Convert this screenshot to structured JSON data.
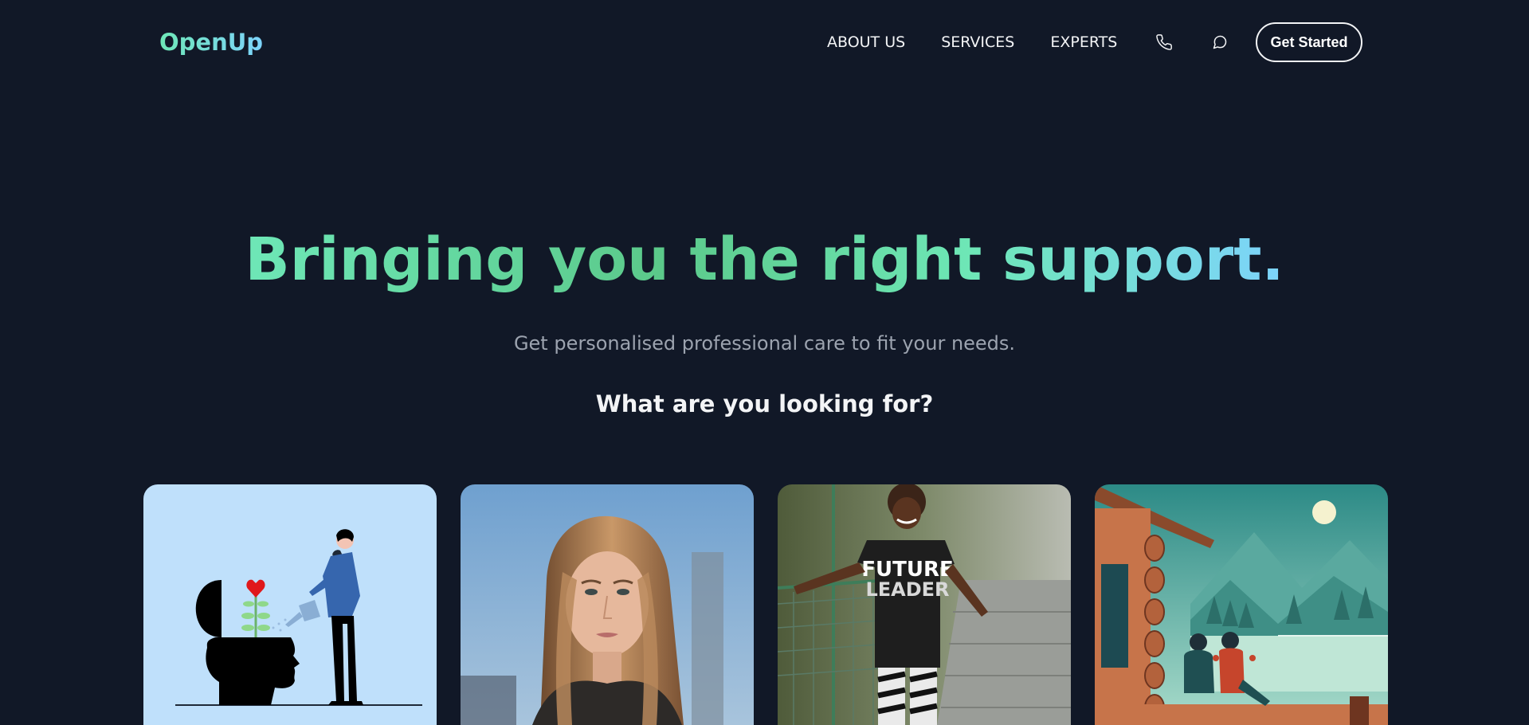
{
  "header": {
    "logo": "OpenUp",
    "nav": [
      {
        "label": "ABOUT US"
      },
      {
        "label": "SERVICES"
      },
      {
        "label": "EXPERTS"
      }
    ],
    "icons": [
      "phone-icon",
      "chat-icon"
    ],
    "cta_label": "Get Started"
  },
  "hero": {
    "title": "Bringing you the right support.",
    "subtitle": "Get personalised professional care to fit your needs.",
    "question": "What are you looking for?"
  },
  "cards": [
    {
      "image": "mind-growth-illustration"
    },
    {
      "image": "young-woman-portrait-photo"
    },
    {
      "image": "child-future-leader-photo"
    },
    {
      "image": "couple-cabin-lake-illustration"
    }
  ],
  "colors": {
    "background": "#111827",
    "accent_green": "#6ee7b7",
    "accent_blue": "#7dd3fc",
    "text_light": "#f3f4f6",
    "text_muted": "#9ca3af"
  }
}
